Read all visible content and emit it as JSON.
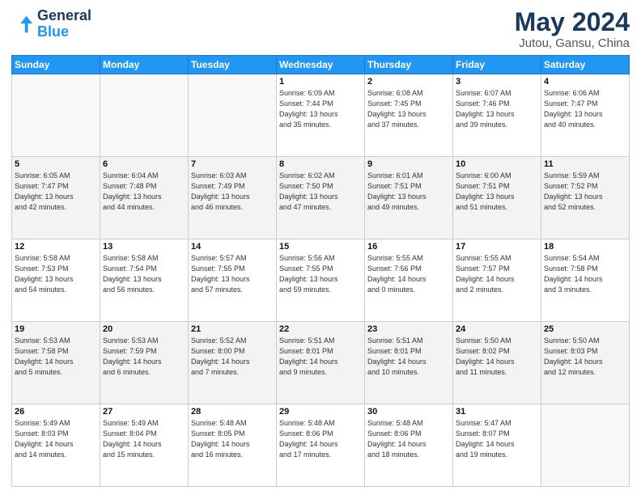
{
  "header": {
    "logo_line1": "General",
    "logo_line2": "Blue",
    "title": "May 2024",
    "subtitle": "Jutou, Gansu, China"
  },
  "weekdays": [
    "Sunday",
    "Monday",
    "Tuesday",
    "Wednesday",
    "Thursday",
    "Friday",
    "Saturday"
  ],
  "weeks": [
    [
      {
        "day": "",
        "info": ""
      },
      {
        "day": "",
        "info": ""
      },
      {
        "day": "",
        "info": ""
      },
      {
        "day": "1",
        "info": "Sunrise: 6:09 AM\nSunset: 7:44 PM\nDaylight: 13 hours\nand 35 minutes."
      },
      {
        "day": "2",
        "info": "Sunrise: 6:08 AM\nSunset: 7:45 PM\nDaylight: 13 hours\nand 37 minutes."
      },
      {
        "day": "3",
        "info": "Sunrise: 6:07 AM\nSunset: 7:46 PM\nDaylight: 13 hours\nand 39 minutes."
      },
      {
        "day": "4",
        "info": "Sunrise: 6:06 AM\nSunset: 7:47 PM\nDaylight: 13 hours\nand 40 minutes."
      }
    ],
    [
      {
        "day": "5",
        "info": "Sunrise: 6:05 AM\nSunset: 7:47 PM\nDaylight: 13 hours\nand 42 minutes."
      },
      {
        "day": "6",
        "info": "Sunrise: 6:04 AM\nSunset: 7:48 PM\nDaylight: 13 hours\nand 44 minutes."
      },
      {
        "day": "7",
        "info": "Sunrise: 6:03 AM\nSunset: 7:49 PM\nDaylight: 13 hours\nand 46 minutes."
      },
      {
        "day": "8",
        "info": "Sunrise: 6:02 AM\nSunset: 7:50 PM\nDaylight: 13 hours\nand 47 minutes."
      },
      {
        "day": "9",
        "info": "Sunrise: 6:01 AM\nSunset: 7:51 PM\nDaylight: 13 hours\nand 49 minutes."
      },
      {
        "day": "10",
        "info": "Sunrise: 6:00 AM\nSunset: 7:51 PM\nDaylight: 13 hours\nand 51 minutes."
      },
      {
        "day": "11",
        "info": "Sunrise: 5:59 AM\nSunset: 7:52 PM\nDaylight: 13 hours\nand 52 minutes."
      }
    ],
    [
      {
        "day": "12",
        "info": "Sunrise: 5:58 AM\nSunset: 7:53 PM\nDaylight: 13 hours\nand 54 minutes."
      },
      {
        "day": "13",
        "info": "Sunrise: 5:58 AM\nSunset: 7:54 PM\nDaylight: 13 hours\nand 56 minutes."
      },
      {
        "day": "14",
        "info": "Sunrise: 5:57 AM\nSunset: 7:55 PM\nDaylight: 13 hours\nand 57 minutes."
      },
      {
        "day": "15",
        "info": "Sunrise: 5:56 AM\nSunset: 7:55 PM\nDaylight: 13 hours\nand 59 minutes."
      },
      {
        "day": "16",
        "info": "Sunrise: 5:55 AM\nSunset: 7:56 PM\nDaylight: 14 hours\nand 0 minutes."
      },
      {
        "day": "17",
        "info": "Sunrise: 5:55 AM\nSunset: 7:57 PM\nDaylight: 14 hours\nand 2 minutes."
      },
      {
        "day": "18",
        "info": "Sunrise: 5:54 AM\nSunset: 7:58 PM\nDaylight: 14 hours\nand 3 minutes."
      }
    ],
    [
      {
        "day": "19",
        "info": "Sunrise: 5:53 AM\nSunset: 7:58 PM\nDaylight: 14 hours\nand 5 minutes."
      },
      {
        "day": "20",
        "info": "Sunrise: 5:53 AM\nSunset: 7:59 PM\nDaylight: 14 hours\nand 6 minutes."
      },
      {
        "day": "21",
        "info": "Sunrise: 5:52 AM\nSunset: 8:00 PM\nDaylight: 14 hours\nand 7 minutes."
      },
      {
        "day": "22",
        "info": "Sunrise: 5:51 AM\nSunset: 8:01 PM\nDaylight: 14 hours\nand 9 minutes."
      },
      {
        "day": "23",
        "info": "Sunrise: 5:51 AM\nSunset: 8:01 PM\nDaylight: 14 hours\nand 10 minutes."
      },
      {
        "day": "24",
        "info": "Sunrise: 5:50 AM\nSunset: 8:02 PM\nDaylight: 14 hours\nand 11 minutes."
      },
      {
        "day": "25",
        "info": "Sunrise: 5:50 AM\nSunset: 8:03 PM\nDaylight: 14 hours\nand 12 minutes."
      }
    ],
    [
      {
        "day": "26",
        "info": "Sunrise: 5:49 AM\nSunset: 8:03 PM\nDaylight: 14 hours\nand 14 minutes."
      },
      {
        "day": "27",
        "info": "Sunrise: 5:49 AM\nSunset: 8:04 PM\nDaylight: 14 hours\nand 15 minutes."
      },
      {
        "day": "28",
        "info": "Sunrise: 5:48 AM\nSunset: 8:05 PM\nDaylight: 14 hours\nand 16 minutes."
      },
      {
        "day": "29",
        "info": "Sunrise: 5:48 AM\nSunset: 8:06 PM\nDaylight: 14 hours\nand 17 minutes."
      },
      {
        "day": "30",
        "info": "Sunrise: 5:48 AM\nSunset: 8:06 PM\nDaylight: 14 hours\nand 18 minutes."
      },
      {
        "day": "31",
        "info": "Sunrise: 5:47 AM\nSunset: 8:07 PM\nDaylight: 14 hours\nand 19 minutes."
      },
      {
        "day": "",
        "info": ""
      }
    ]
  ]
}
